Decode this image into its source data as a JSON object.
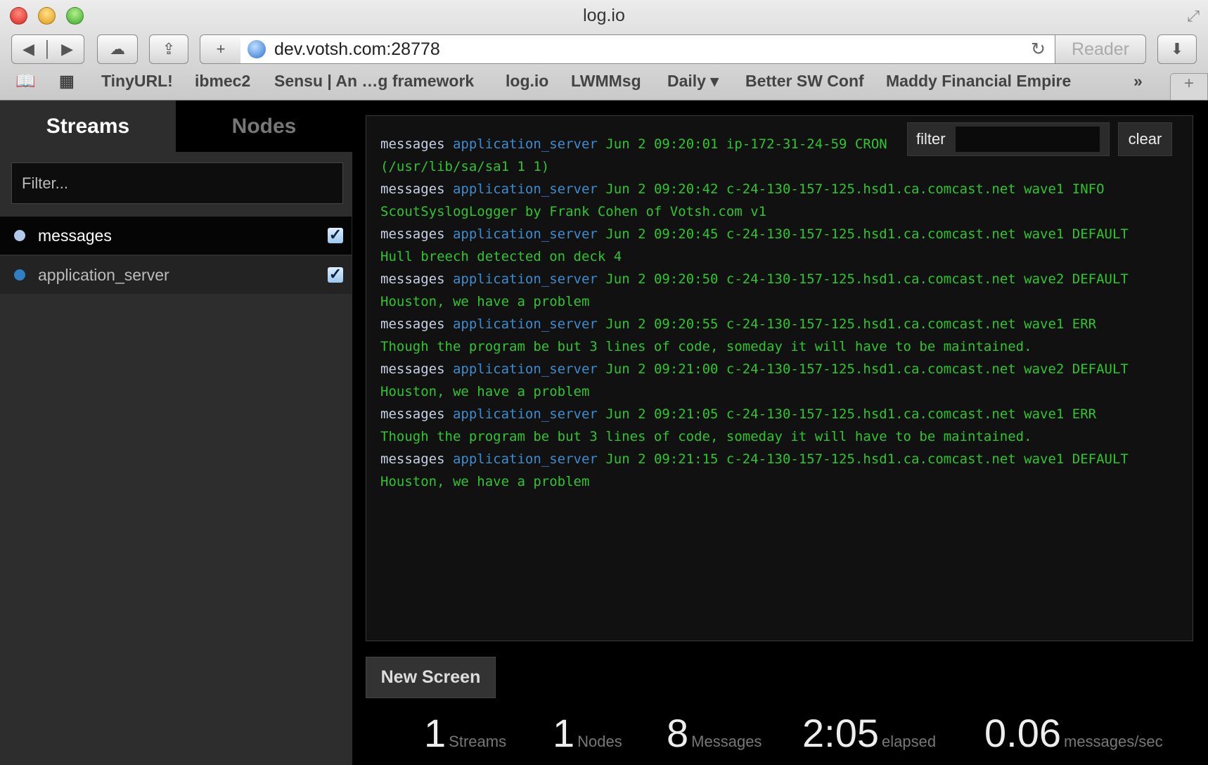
{
  "browser": {
    "title": "log.io",
    "url": "dev.votsh.com:28778",
    "reader": "Reader",
    "bookmarks": [
      "TinyURL!",
      "ibmec2",
      "Sensu | An …g framework",
      "log.io",
      "LWMMsg",
      "Daily ▾",
      "Better SW Conf",
      "Maddy Financial Empire"
    ]
  },
  "sidebar": {
    "tabs": [
      "Streams",
      "Nodes"
    ],
    "filter_placeholder": "Filter...",
    "items": [
      {
        "label": "messages",
        "color": "#b4c8ea",
        "checked": true
      },
      {
        "label": "application_server",
        "color": "#2f7fc4",
        "checked": true
      }
    ]
  },
  "log": {
    "filter_label": "filter",
    "filter_value": "",
    "clear": "clear",
    "lines": [
      {
        "stream": "messages",
        "node": "application_server",
        "text": "Jun 2 09:20:01 ip-172-31-24-59 CRON",
        "cont": "(/usr/lib/sa/sa1 1 1)"
      },
      {
        "stream": "messages",
        "node": "application_server",
        "text": "Jun 2 09:20:42 c-24-130-157-125.hsd1.ca.comcast.net wave1 INFO",
        "cont": "ScoutSyslogLogger by Frank Cohen of Votsh.com v1"
      },
      {
        "stream": "messages",
        "node": "application_server",
        "text": "Jun 2 09:20:45 c-24-130-157-125.hsd1.ca.comcast.net wave1 DEFAULT",
        "cont": "Hull breech detected on deck 4"
      },
      {
        "stream": "messages",
        "node": "application_server",
        "text": "Jun 2 09:20:50 c-24-130-157-125.hsd1.ca.comcast.net wave2 DEFAULT",
        "cont": "Houston, we have a problem"
      },
      {
        "stream": "messages",
        "node": "application_server",
        "text": "Jun 2 09:20:55 c-24-130-157-125.hsd1.ca.comcast.net wave1 ERR",
        "cont": "Though the program be but 3 lines of code, someday it will have to be maintained."
      },
      {
        "stream": "messages",
        "node": "application_server",
        "text": "Jun 2 09:21:00 c-24-130-157-125.hsd1.ca.comcast.net wave2 DEFAULT",
        "cont": "Houston, we have a problem"
      },
      {
        "stream": "messages",
        "node": "application_server",
        "text": "Jun 2 09:21:05 c-24-130-157-125.hsd1.ca.comcast.net wave1 ERR",
        "cont": "Though the program be but 3 lines of code, someday it will have to be maintained."
      },
      {
        "stream": "messages",
        "node": "application_server",
        "text": "Jun 2 09:21:15 c-24-130-157-125.hsd1.ca.comcast.net wave1 DEFAULT",
        "cont": "Houston, we have a problem"
      }
    ]
  },
  "new_screen": "New Screen",
  "stats": [
    {
      "value": "1",
      "label": "Streams"
    },
    {
      "value": "1",
      "label": "Nodes"
    },
    {
      "value": "8",
      "label": "Messages"
    },
    {
      "value": "2:05",
      "label": "elapsed"
    },
    {
      "value": "0.06",
      "label": "messages/sec"
    }
  ]
}
